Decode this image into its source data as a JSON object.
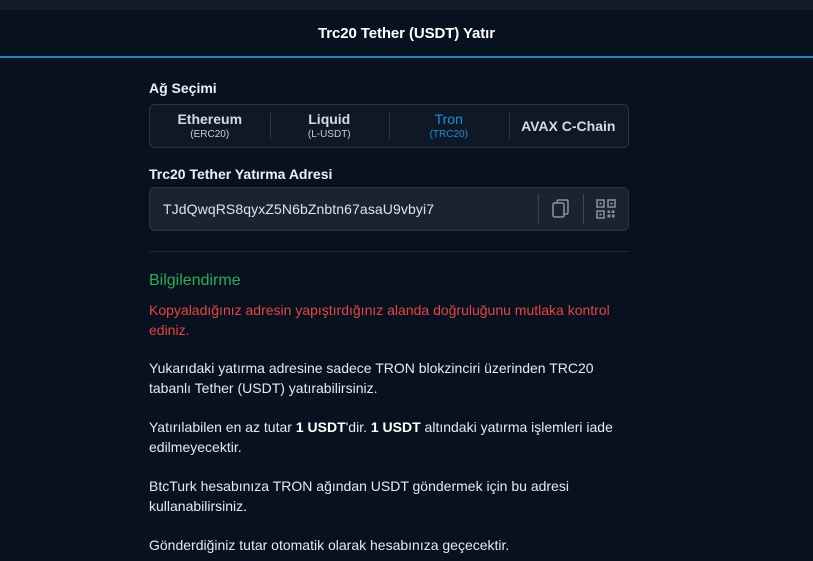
{
  "header": {
    "title": "Trc20 Tether (USDT) Yatır"
  },
  "network": {
    "label": "Ağ Seçimi",
    "options": [
      {
        "name": "Ethereum",
        "sub": "(ERC20)",
        "active": false
      },
      {
        "name": "Liquid",
        "sub": "(L-USDT)",
        "active": false
      },
      {
        "name": "Tron",
        "sub": "(TRC20)",
        "active": true
      },
      {
        "name": "AVAX C-Chain",
        "sub": "",
        "active": false
      }
    ]
  },
  "address": {
    "label": "Trc20 Tether Yatırma Adresi",
    "value": "TJdQwqRS8qyxZ5N6bZnbtn67asaU9vbyi7",
    "copy_icon": "copy-icon",
    "qr_icon": "qr-code-icon"
  },
  "info": {
    "title": "Bilgilendirme",
    "warning": "Kopyaladığınız adresin yapıştırdığınız alanda doğruluğunu mutlaka kontrol ediniz.",
    "p1": "Yukarıdaki yatırma adresine sadece TRON blokzinciri üzerinden TRC20 tabanlı Tether (USDT) yatırabilirsiniz.",
    "p2": {
      "a": "Yatırılabilen en az tutar ",
      "b": "1 USDT",
      "c": "'dir. ",
      "d": "1 USDT",
      "e": " altındaki yatırma işlemleri iade edilmeyecektir."
    },
    "p3": "BtcTurk hesabınıza TRON ağından USDT göndermek için bu adresi kullanabilirsiniz.",
    "p4": "Gönderdiğiniz tutar otomatik olarak hesabınıza geçecektir."
  },
  "colors": {
    "accent": "#1e8fd9",
    "success": "#27b04f",
    "warning": "#e8453b",
    "background": "#081120"
  }
}
